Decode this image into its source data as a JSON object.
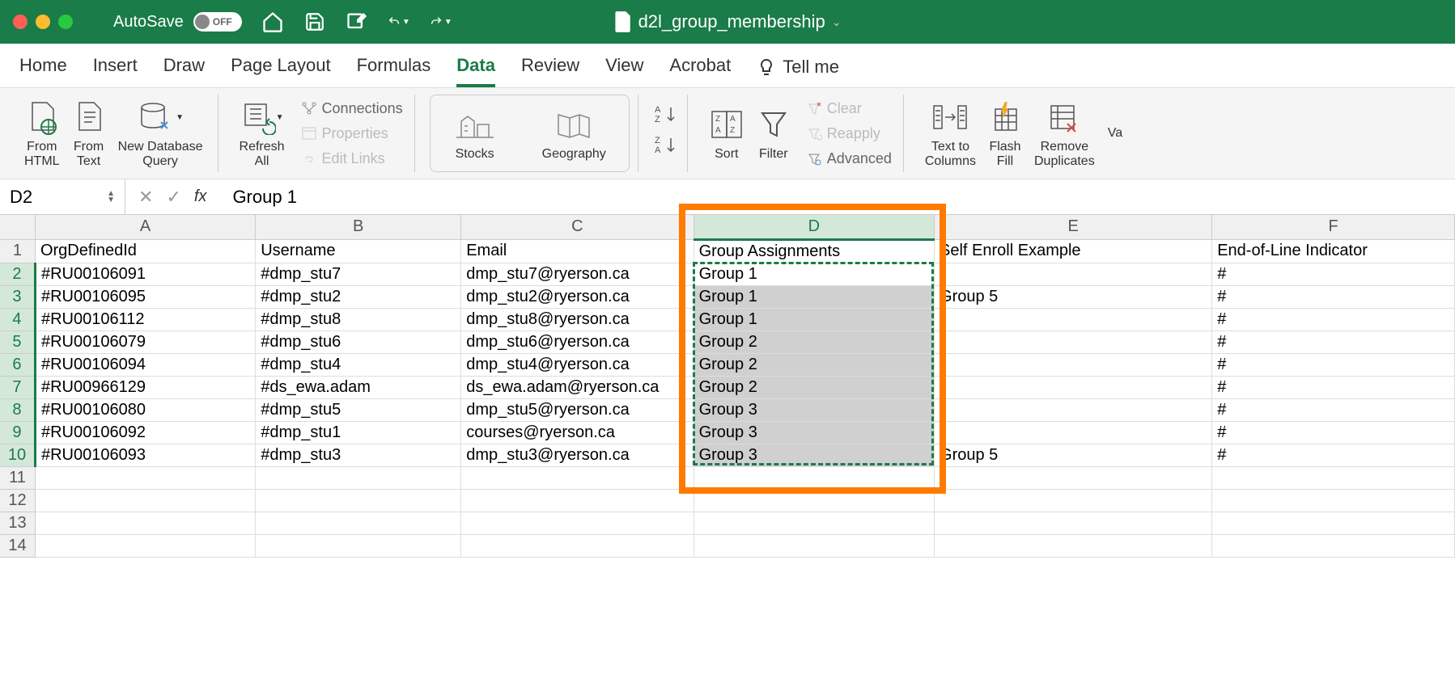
{
  "titlebar": {
    "autosave_label": "AutoSave",
    "autosave_state": "OFF",
    "doc_name": "d2l_group_membership"
  },
  "tabs": {
    "items": [
      "Home",
      "Insert",
      "Draw",
      "Page Layout",
      "Formulas",
      "Data",
      "Review",
      "View",
      "Acrobat"
    ],
    "active_index": 5,
    "tell_me": "Tell me"
  },
  "ribbon": {
    "from_html": "From\nHTML",
    "from_text": "From\nText",
    "new_db_query": "New Database\nQuery",
    "refresh_all": "Refresh\nAll",
    "connections": "Connections",
    "properties": "Properties",
    "edit_links": "Edit Links",
    "stocks": "Stocks",
    "geography": "Geography",
    "sort": "Sort",
    "filter": "Filter",
    "clear": "Clear",
    "reapply": "Reapply",
    "advanced": "Advanced",
    "text_to_columns": "Text to\nColumns",
    "flash_fill": "Flash\nFill",
    "remove_duplicates": "Remove\nDuplicates",
    "validate": "Va"
  },
  "formula_bar": {
    "name_box": "D2",
    "formula": "Group 1"
  },
  "columns": [
    "A",
    "B",
    "C",
    "D",
    "E",
    "F"
  ],
  "selected_col_index": 3,
  "headers": {
    "A": "OrgDefinedId",
    "B": "Username",
    "C": "Email",
    "D": "Group Assignments",
    "E": "Self Enroll Example",
    "F": "End-of-Line Indicator"
  },
  "rows": [
    {
      "A": "#RU00106091",
      "B": "#dmp_stu7",
      "C": "dmp_stu7@ryerson.ca",
      "D": "Group 1",
      "E": "",
      "F": "#"
    },
    {
      "A": "#RU00106095",
      "B": "#dmp_stu2",
      "C": "dmp_stu2@ryerson.ca",
      "D": "Group 1",
      "E": "Group 5",
      "F": "#"
    },
    {
      "A": "#RU00106112",
      "B": "#dmp_stu8",
      "C": "dmp_stu8@ryerson.ca",
      "D": "Group 1",
      "E": "",
      "F": "#"
    },
    {
      "A": "#RU00106079",
      "B": "#dmp_stu6",
      "C": "dmp_stu6@ryerson.ca",
      "D": "Group 2",
      "E": "",
      "F": "#"
    },
    {
      "A": "#RU00106094",
      "B": "#dmp_stu4",
      "C": "dmp_stu4@ryerson.ca",
      "D": "Group 2",
      "E": "",
      "F": "#"
    },
    {
      "A": "#RU00966129",
      "B": "#ds_ewa.adam",
      "C": "ds_ewa.adam@ryerson.ca",
      "D": "Group 2",
      "E": "",
      "F": "#"
    },
    {
      "A": "#RU00106080",
      "B": "#dmp_stu5",
      "C": "dmp_stu5@ryerson.ca",
      "D": "Group 3",
      "E": "",
      "F": "#"
    },
    {
      "A": "#RU00106092",
      "B": "#dmp_stu1",
      "C": "courses@ryerson.ca",
      "D": "Group 3",
      "E": "",
      "F": "#"
    },
    {
      "A": "#RU00106093",
      "B": "#dmp_stu3",
      "C": "dmp_stu3@ryerson.ca",
      "D": "Group 3",
      "E": "Group 5",
      "F": "#"
    }
  ],
  "total_visible_rows": 14
}
